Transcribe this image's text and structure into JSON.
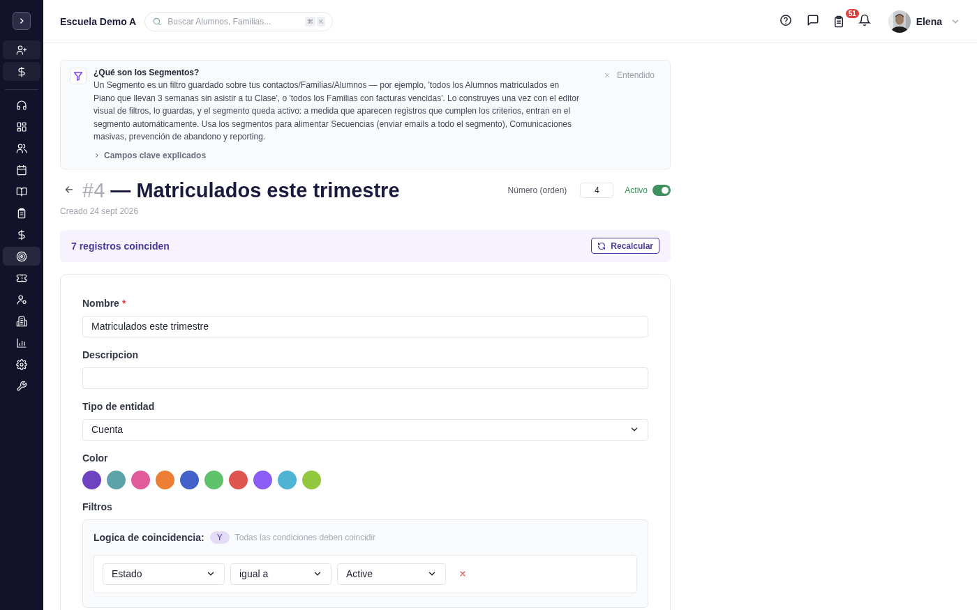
{
  "sidebar": {
    "quick_actions": [
      {
        "kind": "user-plus"
      },
      {
        "kind": "dollar"
      }
    ],
    "nav": [
      {
        "kind": "headset",
        "selected": false
      },
      {
        "kind": "grid",
        "selected": false
      },
      {
        "kind": "users",
        "selected": false
      },
      {
        "kind": "calendar",
        "selected": false
      },
      {
        "kind": "book",
        "selected": false
      },
      {
        "kind": "clipboard",
        "selected": false
      },
      {
        "kind": "dollar",
        "selected": false
      },
      {
        "kind": "target",
        "selected": true
      },
      {
        "kind": "ticket",
        "selected": false
      },
      {
        "kind": "user-gear",
        "selected": false
      },
      {
        "kind": "building",
        "selected": false
      },
      {
        "kind": "chart",
        "selected": false
      },
      {
        "kind": "gear",
        "selected": false
      },
      {
        "kind": "wrench",
        "selected": false
      }
    ]
  },
  "header": {
    "school": "Escuela Demo A",
    "search": {
      "placeholder": "Buscar Alumnos, Familias...",
      "keys": [
        "⌘",
        "K"
      ]
    },
    "tasks_badge": "51",
    "user": {
      "name": "Elena"
    }
  },
  "info": {
    "title": "¿Qué son los Segmentos?",
    "body": "Un Segmento es un filtro guardado sobre tus contactos/Familias/Alumnos — por ejemplo, 'todos los Alumnos matriculados en Piano que llevan 3 semanas sin asistir a tu Clase', o 'todos los Familias con facturas vencidas'. Lo construyes una vez con el editor visual de filtros, lo guardas, y el segmento queda activo: a medida que aparecen registros que cumplen los criterios, entran en el segmento automáticamente. Usa los segmentos para alimentar Secuencias (enviar emails a todo el segmento), Comunicaciones masivas, prevención de abandono y reporting.",
    "dismiss": "Entendido",
    "details": "Campos clave explicados",
    "details_expanded": false
  },
  "segment": {
    "number": "#4",
    "title": "— Matriculados este trimestre",
    "created": "Creado 24 sept 2026",
    "order_label": "Número (orden)",
    "order_value": "4",
    "active_label": "Activo",
    "active": true
  },
  "matches": {
    "text": "7 registros coinciden",
    "button": "Recalcular"
  },
  "form": {
    "fields": [
      {
        "label": "Nombre",
        "required_mark": "*",
        "kind": "text",
        "value": "Matriculados este trimestre"
      },
      {
        "label": "Descripcion",
        "kind": "text"
      },
      {
        "label": "Tipo de entidad",
        "kind": "select",
        "value": "Cuenta"
      }
    ],
    "color_label": "Color",
    "colors": [
      {
        "color": "#6f42c1"
      },
      {
        "color": "#5ba3a8"
      },
      {
        "color": "#e05a9c"
      },
      {
        "color": "#ec7f35"
      },
      {
        "color": "#4361c9"
      },
      {
        "color": "#5dc26a"
      },
      {
        "color": "#e05450"
      },
      {
        "color": "#8b5cf6"
      },
      {
        "color": "#4fb3d4"
      },
      {
        "color": "#93c83e"
      }
    ],
    "filters_label": "Filtros",
    "logic": {
      "label": "Logica de coincidencia:",
      "value": "Y",
      "hint": "Todas las condiciones deben coincidir"
    },
    "conditions": [
      {
        "field": "Estado",
        "operator": "igual a",
        "value": "Active"
      }
    ]
  }
}
